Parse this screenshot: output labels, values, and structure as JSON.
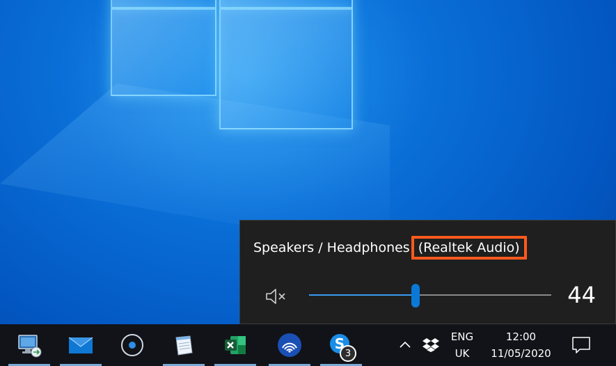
{
  "volume_flyout": {
    "device_prefix": "Speakers / Headphones",
    "device_highlight": "(Realtek Audio)",
    "volume_value": "44",
    "volume_level": 44,
    "highlight_color": "#ff5a1e",
    "accent_color": "#0a78d7",
    "mute_icon": "speaker-muted-icon"
  },
  "taskbar": {
    "apps": [
      {
        "name": "remote-desktop-icon"
      },
      {
        "name": "mail-icon"
      },
      {
        "name": "cortana-icon"
      },
      {
        "name": "notepad-icon"
      },
      {
        "name": "excel-icon"
      },
      {
        "name": "network-app-icon"
      },
      {
        "name": "skype-icon",
        "badge": "3"
      }
    ],
    "tray": {
      "language_line1": "ENG",
      "language_line2": "UK",
      "time": "12:00",
      "date": "11/05/2020"
    }
  }
}
